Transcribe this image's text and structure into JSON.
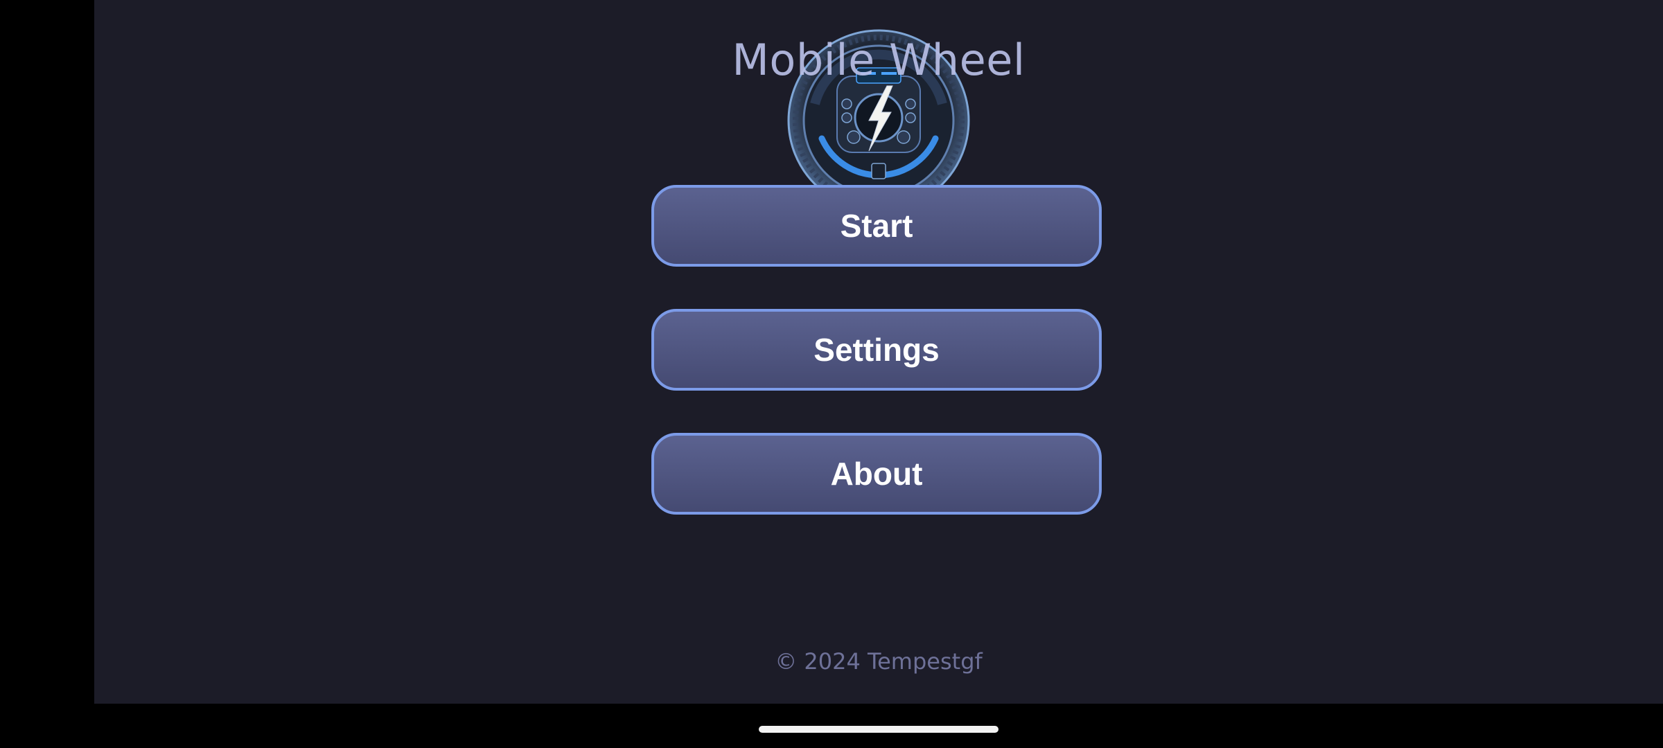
{
  "app": {
    "title": "Mobile Wheel",
    "logo_icon": "steering-wheel-lightning-logo",
    "accent_color": "#7c9be8",
    "background_color": "#1c1c28"
  },
  "menu": {
    "start_label": "Start",
    "settings_label": "Settings",
    "about_label": "About"
  },
  "footer": {
    "copyright": "© 2024 Tempestgf"
  }
}
